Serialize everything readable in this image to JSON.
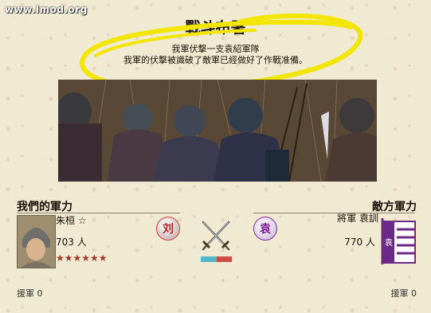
{
  "site": {
    "watermark": "www.lmod.org"
  },
  "header": {
    "title": "戰斗布署",
    "message_line1": "我軍伏擊一支袁紹軍隊",
    "message_line2": "我軍的伏擊被識破了敵軍已經做好了作戰准備。"
  },
  "our_side": {
    "heading": "我們的軍力",
    "general": "朱桓 ☆",
    "troops": "703 人",
    "stars": "★★★★★★",
    "seal_char": "刘",
    "reinforcement": "援軍 0"
  },
  "enemy_side": {
    "heading": "敵方軍力",
    "general": "將軍 袁訓",
    "troops": "770 人",
    "seal_char": "袁",
    "banner_char": "袁",
    "reinforcement": "援軍 0"
  },
  "morale": {
    "ours": 0.51,
    "enemy": 0.49
  },
  "colors": {
    "background": "#f1ead2",
    "highlight_scribble": "#f2e600",
    "our_seal": "#c02020",
    "enemy_seal": "#7a1c94",
    "our_bar": "#4fb7c9",
    "enemy_bar": "#cf4c45",
    "banner": "#6b2a86"
  },
  "icons": [
    "crossed-swords-icon",
    "clan-seal-icon",
    "war-banner-icon"
  ]
}
